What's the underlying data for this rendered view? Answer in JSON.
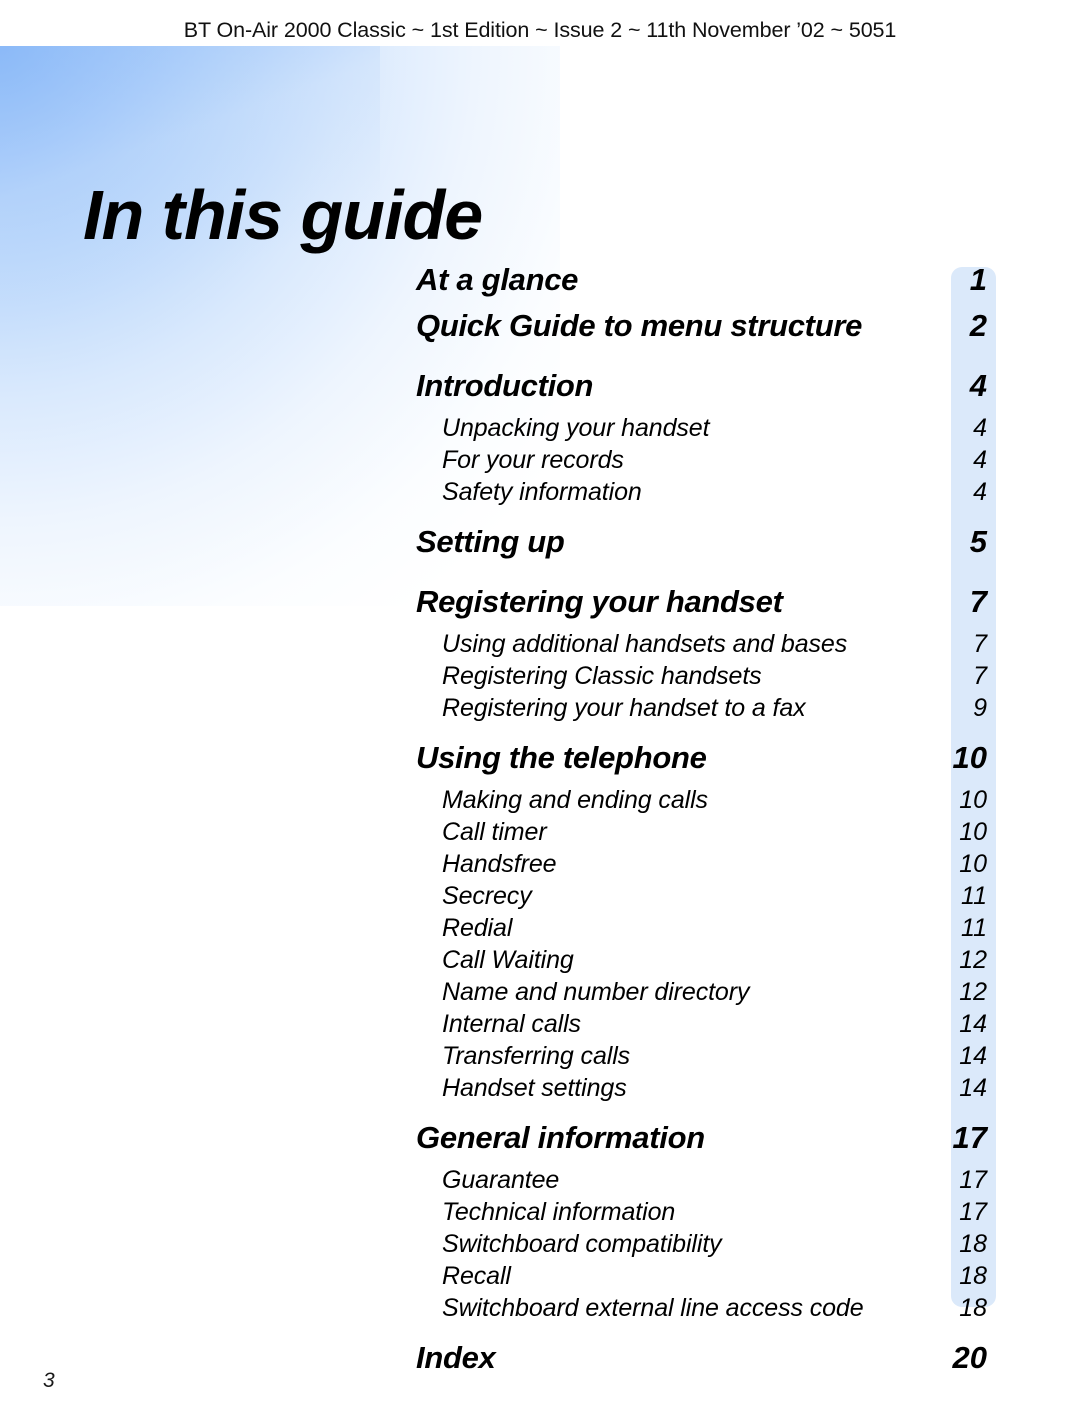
{
  "header": {
    "running_head": "BT On-Air 2000 Classic ~ 1st Edition ~ Issue 2 ~ 11th November ’02 ~ 5051"
  },
  "title": "In this guide",
  "colors": {
    "page_number_strip": "#dbe9fa",
    "corner_gradient_blue": "#8ab9f8",
    "text": "#000000"
  },
  "toc": {
    "entries": [
      {
        "level": "main",
        "label": "At a glance",
        "page": "1",
        "gap_before": false
      },
      {
        "level": "main",
        "label": "Quick Guide to menu structure",
        "page": "2",
        "gap_before": false
      },
      {
        "level": "main",
        "label": "Introduction",
        "page": "4",
        "gap_before": true
      },
      {
        "level": "sub",
        "label": "Unpacking your handset",
        "page": "4",
        "gap_before": false
      },
      {
        "level": "sub",
        "label": "For your records",
        "page": "4",
        "gap_before": false
      },
      {
        "level": "sub",
        "label": "Safety information",
        "page": "4",
        "gap_before": false
      },
      {
        "level": "main",
        "label": "Setting up",
        "page": "5",
        "gap_before": true
      },
      {
        "level": "main",
        "label": "Registering your handset",
        "page": "7",
        "gap_before": true
      },
      {
        "level": "sub",
        "label": "Using additional handsets and bases",
        "page": "7",
        "gap_before": false
      },
      {
        "level": "sub",
        "label": "Registering Classic handsets",
        "page": "7",
        "gap_before": false
      },
      {
        "level": "sub",
        "label": "Registering your handset to a fax",
        "page": "9",
        "gap_before": false
      },
      {
        "level": "main",
        "label": "Using the telephone",
        "page": "10",
        "gap_before": true
      },
      {
        "level": "sub",
        "label": "Making and ending calls",
        "page": "10",
        "gap_before": false
      },
      {
        "level": "sub",
        "label": "Call timer",
        "page": "10",
        "gap_before": false
      },
      {
        "level": "sub",
        "label": "Handsfree",
        "page": "10",
        "gap_before": false
      },
      {
        "level": "sub",
        "label": "Secrecy",
        "page": "11",
        "gap_before": false
      },
      {
        "level": "sub",
        "label": "Redial",
        "page": "11",
        "gap_before": false
      },
      {
        "level": "sub",
        "label": "Call Waiting",
        "page": "12",
        "gap_before": false
      },
      {
        "level": "sub",
        "label": "Name and number directory",
        "page": "12",
        "gap_before": false
      },
      {
        "level": "sub",
        "label": "Internal calls",
        "page": "14",
        "gap_before": false
      },
      {
        "level": "sub",
        "label": "Transferring calls",
        "page": "14",
        "gap_before": false
      },
      {
        "level": "sub",
        "label": "Handset settings",
        "page": "14",
        "gap_before": false
      },
      {
        "level": "main",
        "label": "General information",
        "page": "17",
        "gap_before": true
      },
      {
        "level": "sub",
        "label": "Guarantee",
        "page": "17",
        "gap_before": false
      },
      {
        "level": "sub",
        "label": "Technical information",
        "page": "17",
        "gap_before": false
      },
      {
        "level": "sub",
        "label": "Switchboard compatibility",
        "page": "18",
        "gap_before": false
      },
      {
        "level": "sub",
        "label": "Recall",
        "page": "18",
        "gap_before": false
      },
      {
        "level": "sub",
        "label": "Switchboard external line access code",
        "page": "18",
        "gap_before": false
      },
      {
        "level": "main",
        "label": "Index",
        "page": "20",
        "gap_before": true
      }
    ]
  },
  "footer": {
    "folio": "3"
  }
}
